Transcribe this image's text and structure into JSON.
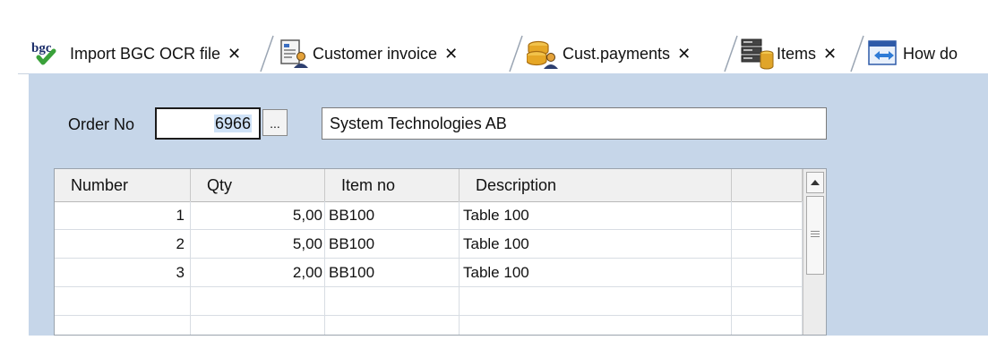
{
  "tabs": [
    {
      "label": "Import BGC OCR file",
      "icon": "bgc-import-icon"
    },
    {
      "label": "Customer invoice",
      "icon": "invoice-document-icon"
    },
    {
      "label": "Cust.payments",
      "icon": "coins-payment-icon"
    },
    {
      "label": "Items",
      "icon": "items-database-icon"
    },
    {
      "label": "How do",
      "icon": "help-window-icon"
    }
  ],
  "tab_close_glyph": "✕",
  "bgc_logo_text": "bgc",
  "form": {
    "order_label": "Order No",
    "order_value": "6966",
    "browse_label": "...",
    "customer_name": "System Technologies AB"
  },
  "grid": {
    "columns": [
      "Number",
      "Qty",
      "Item no",
      "Description"
    ],
    "rows": [
      {
        "number": "1",
        "qty": "5,00",
        "item_no": "BB100",
        "description": "Table 100"
      },
      {
        "number": "2",
        "qty": "5,00",
        "item_no": "BB100",
        "description": "Table 100"
      },
      {
        "number": "3",
        "qty": "2,00",
        "item_no": "BB100",
        "description": "Table 100"
      },
      {
        "number": "",
        "qty": "",
        "item_no": "",
        "description": ""
      },
      {
        "number": "",
        "qty": "",
        "item_no": "",
        "description": ""
      }
    ]
  },
  "colors": {
    "content_background": "#c6d6e9",
    "input_border": "#1b1b1b"
  }
}
